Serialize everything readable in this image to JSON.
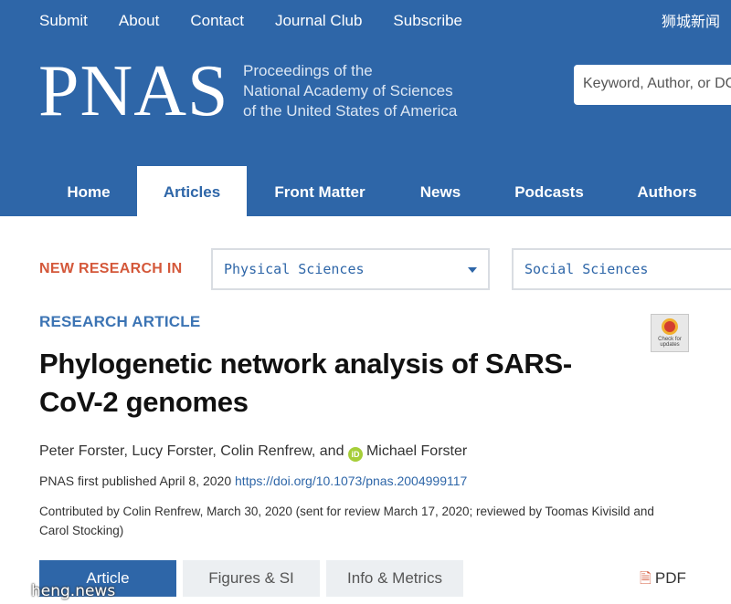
{
  "top_links": [
    "Submit",
    "About",
    "Contact",
    "Journal Club",
    "Subscribe"
  ],
  "watermark_top": "狮城新闻",
  "logo": "PNAS",
  "tagline": [
    "Proceedings of the",
    "National Academy of Sciences",
    "of the United States of America"
  ],
  "search": {
    "placeholder": "Keyword, Author, or DOI"
  },
  "nav": [
    "Home",
    "Articles",
    "Front Matter",
    "News",
    "Podcasts",
    "Authors"
  ],
  "nav_active": "Articles",
  "filter": {
    "label": "NEW RESEARCH IN",
    "select1": "Physical Sciences",
    "select2": "Social Sciences"
  },
  "article": {
    "type": "RESEARCH ARTICLE",
    "title_line1": "Phylogenetic network analysis of SARS-",
    "title_line2": "CoV-2 genomes",
    "authors_before_orcid": "Peter Forster, Lucy Forster, Colin Renfrew, and",
    "orcid_glyph": "iD",
    "authors_after_orcid": "Michael Forster",
    "pub_text": "PNAS first published April 8, 2020",
    "doi": "https://doi.org/10.1073/pnas.2004999117",
    "contrib_line1": "Contributed by Colin Renfrew, March 30, 2020 (sent for review March 17, 2020; reviewed by Toomas Kivisild and",
    "contrib_line2": "Carol Stocking)",
    "check_updates": "Check for updates"
  },
  "tabs": [
    "Article",
    "Figures & SI",
    "Info & Metrics"
  ],
  "tab_active": "Article",
  "pdf_label": "PDF",
  "watermark_bottom": "heng.news",
  "colors": {
    "brand_blue": "#2e66a8",
    "accent_orange": "#d4583a"
  }
}
